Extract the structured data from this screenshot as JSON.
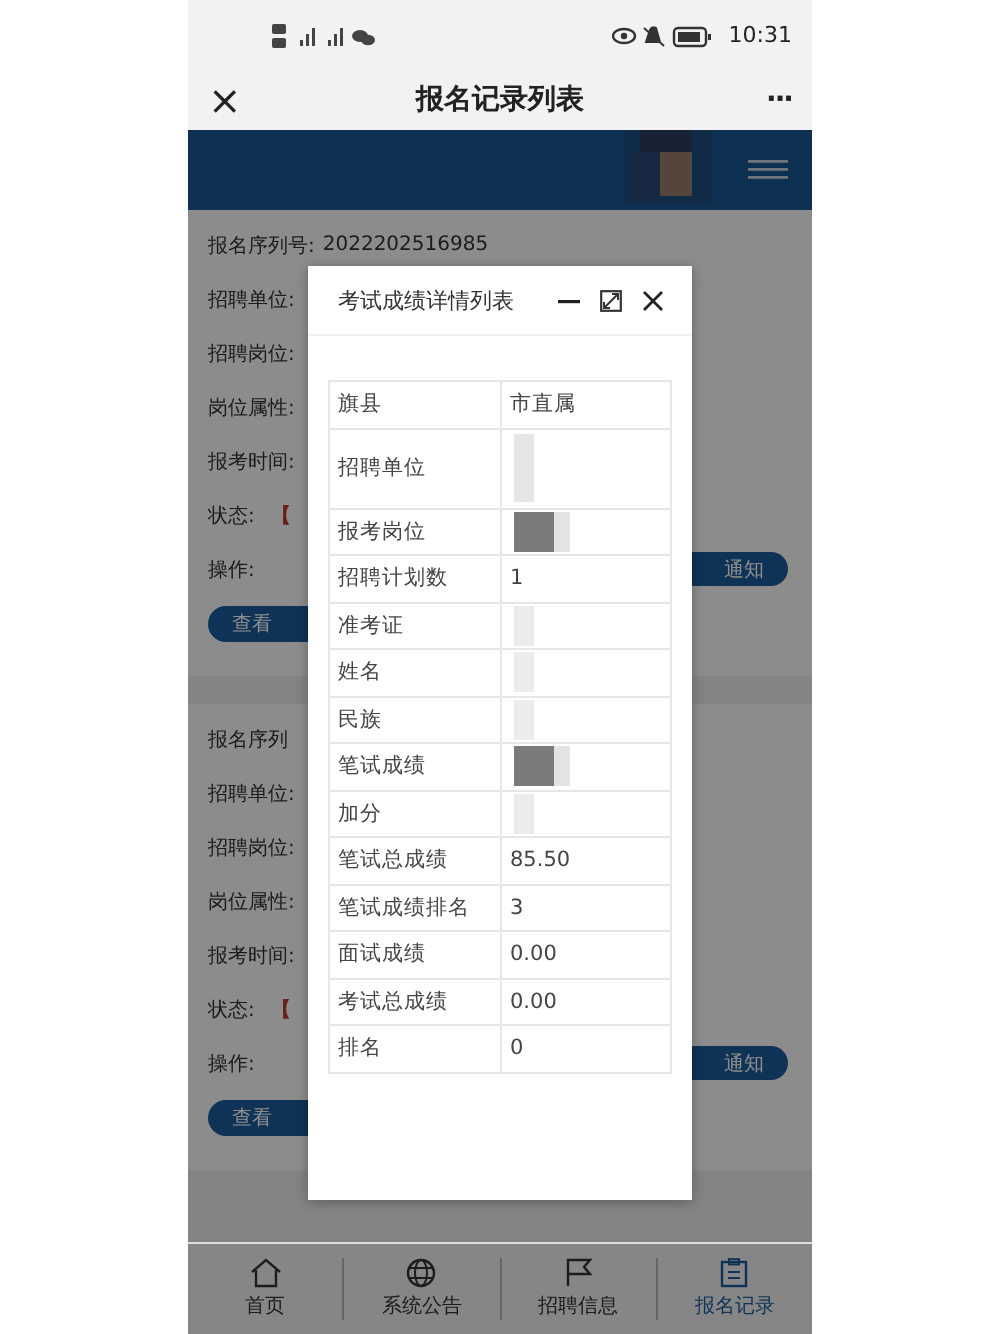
{
  "status_bar": {
    "time": "10:31"
  },
  "nav": {
    "close": "×",
    "title": "报名记录列表",
    "more": "···"
  },
  "records": [
    {
      "fields": [
        {
          "label": "报名序列号:",
          "value": "2022202516985"
        },
        {
          "label": "招聘单位:"
        },
        {
          "label": "招聘岗位:"
        },
        {
          "label": "岗位属性:"
        },
        {
          "label": "报考时间:"
        },
        {
          "label": "状态:",
          "value": "【",
          "kind": "status"
        },
        {
          "label": "操作:"
        }
      ],
      "right_button": "通知",
      "left_button": "查看"
    },
    {
      "fields": [
        {
          "label": "报名序列"
        },
        {
          "label": "招聘单位:"
        },
        {
          "label": "招聘岗位:"
        },
        {
          "label": "岗位属性:"
        },
        {
          "label": "报考时间:"
        },
        {
          "label": "状态:",
          "value": "【",
          "kind": "status"
        },
        {
          "label": "操作:"
        }
      ],
      "right_button": "通知",
      "left_button": "查看"
    }
  ],
  "dialog": {
    "title": "考试成绩详情列表",
    "rows": [
      {
        "label": "旗县",
        "value": "市直属"
      },
      {
        "label": "招聘单位",
        "kind": "tall"
      },
      {
        "label": "报考岗位",
        "kind": "block"
      },
      {
        "label": "招聘计划数",
        "value": "1"
      },
      {
        "label": "准考证",
        "kind": "blur"
      },
      {
        "label": "姓名",
        "kind": "blur"
      },
      {
        "label": "民族",
        "kind": "blur"
      },
      {
        "label": "笔试成绩",
        "kind": "block"
      },
      {
        "label": "加分",
        "kind": "blur"
      },
      {
        "label": "笔试总成绩",
        "value": "85.50"
      },
      {
        "label": "笔试成绩排名",
        "value": "3"
      },
      {
        "label": "面试成绩",
        "value": "0.00"
      },
      {
        "label": "考试总成绩",
        "value": "0.00"
      },
      {
        "label": "排名",
        "value": "0"
      }
    ]
  },
  "tabbar": [
    {
      "label": "首页",
      "kind": "home",
      "selected": false
    },
    {
      "label": "系统公告",
      "kind": "globe",
      "selected": false
    },
    {
      "label": "招聘信息",
      "kind": "flag",
      "selected": false
    },
    {
      "label": "报名记录",
      "kind": "clipboard",
      "selected": true
    }
  ]
}
